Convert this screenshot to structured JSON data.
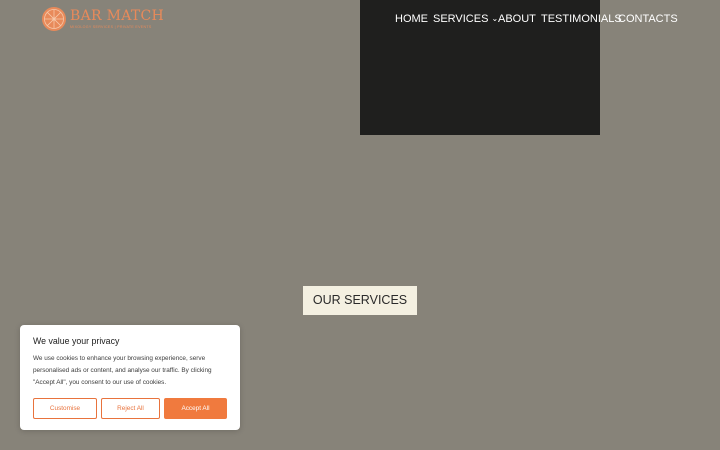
{
  "brand": {
    "name": "BAR MATCH",
    "tagline": "MIXOLOGY SERVICES | PRIVATE EVENTS",
    "color": "#e88a5a"
  },
  "nav": {
    "items": [
      {
        "label": "HOME"
      },
      {
        "label": "SERVICES",
        "chevron": "⌄"
      },
      {
        "label": "ABOUT"
      },
      {
        "label": "TESTIMONIALS"
      },
      {
        "label": "CONTACTS"
      }
    ]
  },
  "sections": {
    "services_heading": "OUR SERVICES"
  },
  "cookie_banner": {
    "title": "We value your privacy",
    "text": "We use cookies to enhance your browsing experience, serve personalised ads or content, and analyse our traffic. By clicking \"Accept All\", you consent to our use of cookies.",
    "customise_label": "Customise",
    "reject_label": "Reject All",
    "accept_label": "Accept All",
    "accent_color": "#f07a3e"
  },
  "colors": {
    "background": "#878379",
    "media_block": "#1f1f1e",
    "services_label_bg": "#f4f0e1"
  }
}
